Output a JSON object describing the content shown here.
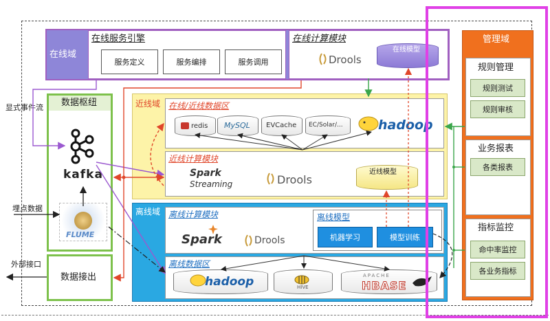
{
  "online_domain": {
    "label": "在线域",
    "service_engine": {
      "title": "在线服务引擎",
      "buttons": [
        "服务定义",
        "服务编排",
        "服务调用"
      ]
    },
    "compute": {
      "title": "在线计算模块",
      "drools": "Drools",
      "model": "在线模型"
    }
  },
  "left": {
    "event_stream": "显式事件流",
    "hub_title": "数据枢纽",
    "kafka": "kafka",
    "flume": "FLUME",
    "tracking": "埋点数据",
    "external": "外部接口",
    "data_out": "数据接出"
  },
  "nearline": {
    "label": "近线域",
    "data_zone": {
      "title": "在线/近线数据区",
      "stores": [
        "redis",
        "MySQL",
        "EVCache",
        "EC/Solar/..."
      ],
      "hadoop": "hadoop"
    },
    "compute": {
      "title": "近线计算模块",
      "spark_line1": "Spark",
      "spark_line2": "Streaming",
      "drools": "Drools",
      "model": "近线模型"
    }
  },
  "offline": {
    "label": "离线域",
    "compute": {
      "title": "离线计算模块",
      "spark": "Spark",
      "drools": "Drools"
    },
    "models": {
      "title": "离线模型",
      "buttons": [
        "机器学习",
        "模型训练"
      ]
    },
    "data_zone": {
      "title": "离线数据区",
      "hadoop": "hadoop",
      "hive": "HIVE",
      "hbase_top": "APACHE",
      "hbase": "HBASE"
    }
  },
  "management": {
    "title": "管理域",
    "groups": [
      {
        "title": "规则管理",
        "items": [
          "规则测试",
          "规则审核"
        ]
      },
      {
        "title": "业务报表",
        "items": [
          "各类报表"
        ]
      },
      {
        "title": "指标监控",
        "items": [
          "命中率监控",
          "各业务指标"
        ]
      }
    ]
  },
  "colors": {
    "online_fill": "#8e86d8",
    "online_border": "#a05fc0",
    "hub_green": "#7dc14b",
    "nearline_fill": "#fdf3a8",
    "offline_fill": "#2aa8e2",
    "mgmt_orange": "#f0701e",
    "magenta": "#e040e6",
    "red_line": "#e0462a"
  }
}
